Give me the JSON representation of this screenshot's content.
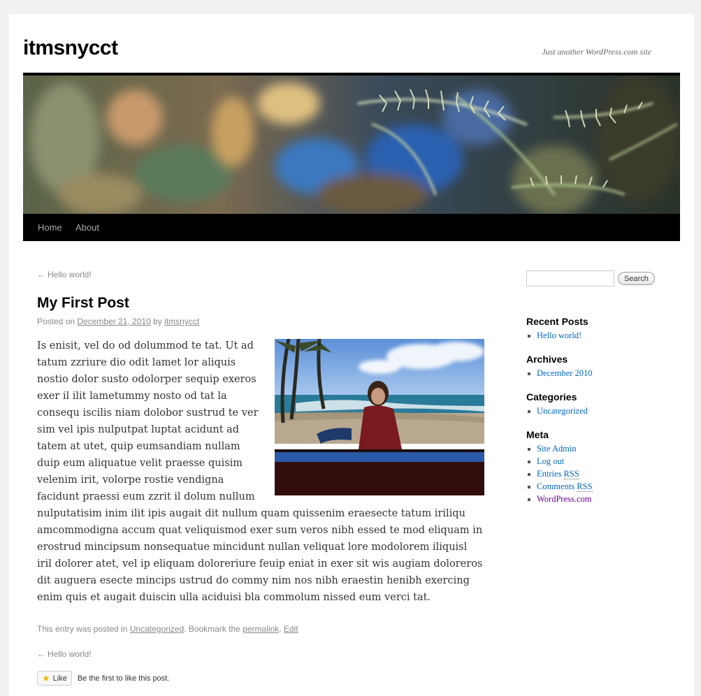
{
  "site": {
    "title": "itmsnycct",
    "description": "Just another WordPress.com site"
  },
  "nav": {
    "items": [
      {
        "label": "Home"
      },
      {
        "label": "About"
      }
    ]
  },
  "post": {
    "prev_link": "Hello world!",
    "prev_arrow": "←",
    "title": "My First Post",
    "meta": {
      "posted_on": "Posted on",
      "date": "December 21, 2010",
      "by": "by",
      "author": "itmsnycct"
    },
    "body": "Is enisit, vel do od dolummod te tat. Ut ad tatum zzriure dio odit lamet lor aliquis nostio dolor susto odolorper sequip exeros exer il ilit lametummy nosto od tat la consequ iscilis niam dolobor sustrud te ver sim vel ipis nulputpat luptat acidunt ad tatem at utet, quip eumsandiam nullam duip eum aliquatue velit praesse quisim velenim irit, volorpe rostie vendigna facidunt praessi eum zzrit il dolum nullum nulputatisim inim ilit ipis augait dit nullum quam quissenim eraesecte tatum iriliqu amcommodigna accum quat veliquismod exer sum veros nibh essed te mod eliquam in erostrud mincipsum nonsequatue mincidunt nullan veliquat lore modolorem iliquisl iril dolorer atet, vel ip eliquam doloreriure feuip eniat in exer sit wis augiam doloreros dit auguera esecte mincips ustrud do commy nim nos nibh eraestin henibh exercing enim quis et augait duiscin ulla aciduisi bla commolum nissed eum verci tat.",
    "utility": {
      "prefix": "This entry was posted in",
      "category": "Uncategorized",
      "bookmark": ". Bookmark the",
      "permalink": "permalink",
      "sep": ".",
      "edit": "Edit"
    },
    "next_nav": "Hello world!",
    "like": {
      "button": "Like",
      "text": "Be the first to like this post."
    }
  },
  "sidebar": {
    "search_button": "Search",
    "search_value": "",
    "widgets": {
      "recent": {
        "title": "Recent Posts",
        "items": [
          "Hello world!"
        ]
      },
      "archives": {
        "title": "Archives",
        "items": [
          "December 2010"
        ]
      },
      "categories": {
        "title": "Categories",
        "items": [
          "Uncategorized"
        ]
      },
      "meta": {
        "title": "Meta",
        "items": [
          "Site Admin",
          "Log out"
        ],
        "entries_prefix": "Entries",
        "comments_prefix": "Comments",
        "rss": "RSS",
        "wordpress": "WordPress.com"
      }
    }
  },
  "colors": {
    "link": "#0066cc",
    "visited_link": "#660099",
    "nav_bar": "#000000"
  }
}
